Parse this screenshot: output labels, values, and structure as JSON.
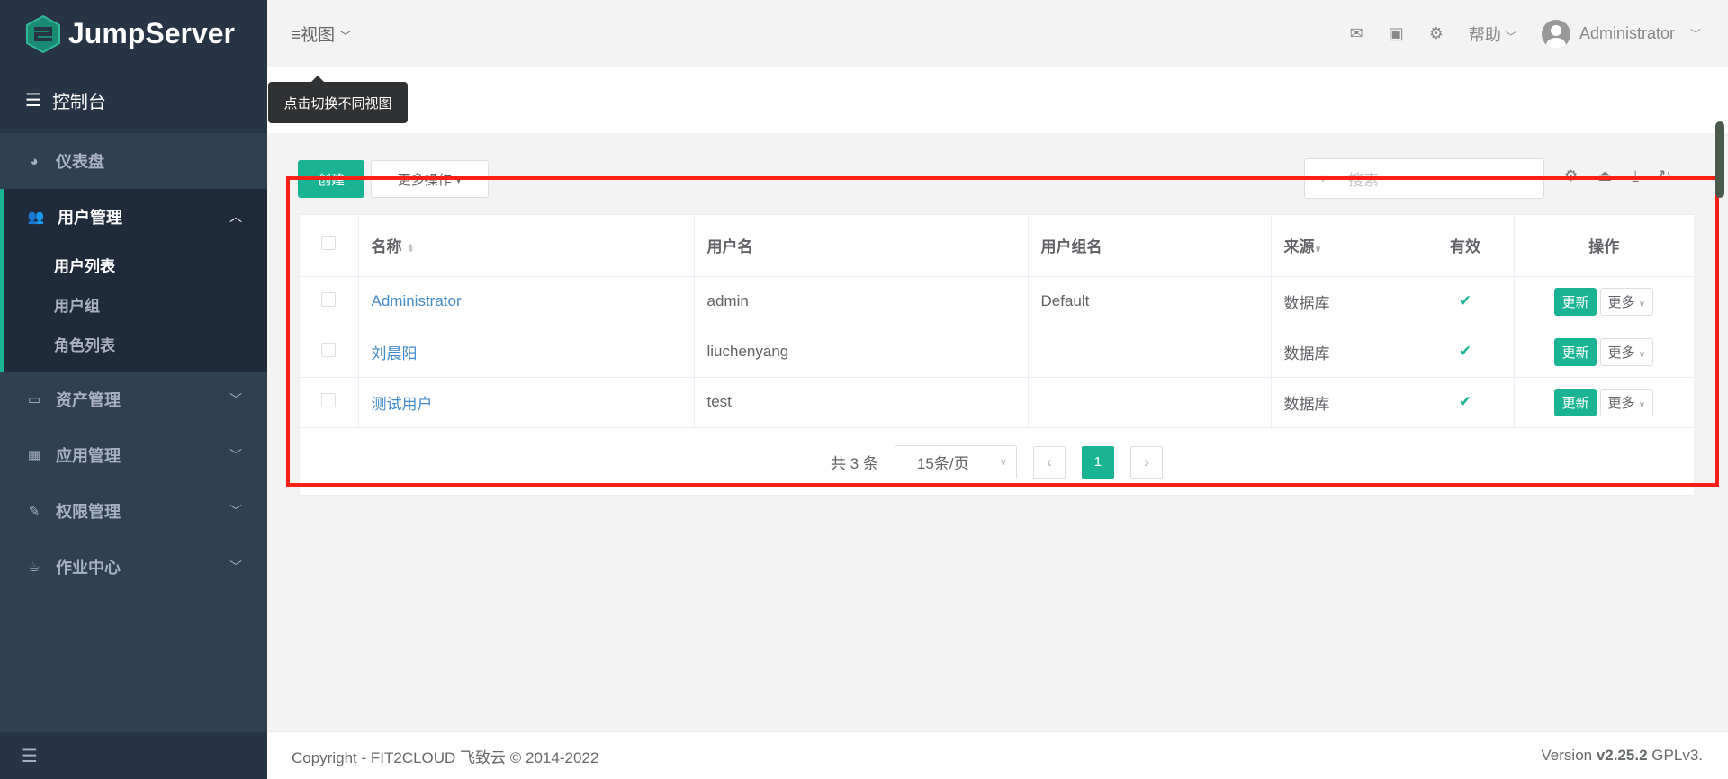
{
  "brand": {
    "name": "JumpServer",
    "accent": "#1ab394"
  },
  "sidebar": {
    "console": "控制台",
    "items": [
      {
        "label": "仪表盘",
        "icon": "dashboard-icon"
      },
      {
        "label": "用户管理",
        "icon": "users-icon",
        "expanded": true,
        "children": [
          "用户列表",
          "用户组",
          "角色列表"
        ]
      },
      {
        "label": "资产管理",
        "icon": "inbox-icon"
      },
      {
        "label": "应用管理",
        "icon": "grid-icon"
      },
      {
        "label": "权限管理",
        "icon": "edit-icon"
      },
      {
        "label": "作业中心",
        "icon": "coffee-icon"
      }
    ]
  },
  "header": {
    "view": "视图",
    "tooltip": "点击切换不同视图",
    "help": "帮助",
    "user": "Administrator"
  },
  "toolbar": {
    "create": "创建",
    "more_actions": "更多操作",
    "search_placeholder": "搜索"
  },
  "table": {
    "columns": [
      "名称",
      "用户名",
      "用户组名",
      "来源",
      "有效",
      "操作"
    ],
    "rows": [
      {
        "name": "Administrator",
        "username": "admin",
        "group": "Default",
        "source": "数据库",
        "valid": true
      },
      {
        "name": "刘晨阳",
        "username": "liuchenyang",
        "group": "",
        "source": "数据库",
        "valid": true
      },
      {
        "name": "测试用户",
        "username": "test",
        "group": "",
        "source": "数据库",
        "valid": true
      }
    ],
    "update": "更新",
    "more": "更多"
  },
  "pagination": {
    "total": "共 3 条",
    "page_size": "15条/页",
    "current": "1"
  },
  "footer": {
    "copyright": "Copyright - FIT2CLOUD 飞致云 © 2014-2022",
    "version_prefix": "Version ",
    "version": "v2.25.2",
    "license": " GPLv3."
  }
}
